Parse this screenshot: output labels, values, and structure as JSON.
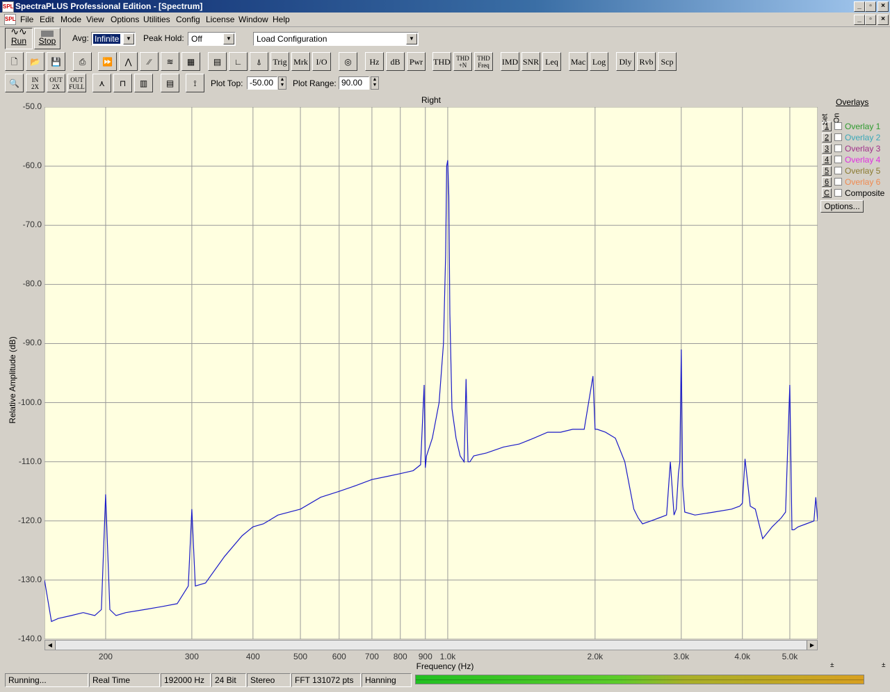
{
  "window": {
    "title": "SpectraPLUS Professional Edition - [Spectrum]",
    "icon_text": "SPL"
  },
  "menu": [
    "File",
    "Edit",
    "Mode",
    "View",
    "Options",
    "Utilities",
    "Config",
    "License",
    "Window",
    "Help"
  ],
  "toolbar": {
    "run_label": "Run",
    "stop_label": "Stop",
    "avg_label": "Avg:",
    "avg_value": "Infinite",
    "peak_hold_label": "Peak Hold:",
    "peak_hold_value": "Off",
    "load_config_value": "Load Configuration",
    "buttons": [
      "Trig",
      "Mrk",
      "I/O",
      "Hz",
      "dB",
      "Pwr",
      "THD",
      "THD +N",
      "THD Freq",
      "IMD",
      "SNR",
      "Leq",
      "Mac",
      "Log",
      "Dly",
      "Rvb",
      "Scp"
    ],
    "plot_top_label": "Plot Top:",
    "plot_top_value": "-50.00",
    "plot_range_label": "Plot Range:",
    "plot_range_value": "90.00"
  },
  "overlays": {
    "title": "Overlays",
    "col_set": "Set",
    "col_on": "On",
    "items": [
      {
        "set": "1",
        "label": "Overlay 1",
        "color": "#2e9a2e"
      },
      {
        "set": "2",
        "label": "Overlay 2",
        "color": "#3aa8b8"
      },
      {
        "set": "3",
        "label": "Overlay 3",
        "color": "#a0308a"
      },
      {
        "set": "4",
        "label": "Overlay 4",
        "color": "#e030e0"
      },
      {
        "set": "5",
        "label": "Overlay 5",
        "color": "#8a7a30"
      },
      {
        "set": "6",
        "label": "Overlay 6",
        "color": "#f08a50"
      },
      {
        "set": "C",
        "label": "Composite",
        "color": "#000000"
      }
    ],
    "options_label": "Options..."
  },
  "chart_data": {
    "type": "line",
    "title": "Right",
    "xlabel": "Frequency (Hz)",
    "ylabel": "Relative Amplitude (dB)",
    "xscale": "log",
    "xlim": [
      150,
      5700
    ],
    "ylim": [
      -140,
      -50
    ],
    "grid": true,
    "background": "#ffffe0",
    "line_color": "#1a1ac8",
    "yticks": [
      "-50.0",
      "-60.0",
      "-70.0",
      "-80.0",
      "-90.0",
      "-100.0",
      "-110.0",
      "-120.0",
      "-130.0",
      "-140.0"
    ],
    "xticks": [
      "200",
      "300",
      "400",
      "500",
      "600",
      "700",
      "800",
      "900",
      "1.0k",
      "2.0k",
      "3.0k",
      "4.0k",
      "5.0k"
    ],
    "series": [
      {
        "x": [
          150,
          155,
          160,
          170,
          180,
          190,
          196,
          200,
          204,
          210,
          220,
          240,
          260,
          280,
          295,
          300,
          305,
          320,
          350,
          380,
          400,
          420,
          450,
          500,
          550,
          600,
          650,
          700,
          750,
          800,
          850,
          880,
          895,
          900,
          905,
          930,
          960,
          980,
          990,
          995,
          1000,
          1005,
          1010,
          1020,
          1040,
          1060,
          1080,
          1090,
          1100,
          1110,
          1130,
          1200,
          1300,
          1400,
          1500,
          1600,
          1700,
          1800,
          1900,
          1980,
          2000,
          2020,
          2100,
          2200,
          2300,
          2400,
          2450,
          2500,
          2600,
          2700,
          2800,
          2850,
          2900,
          2930,
          2960,
          2980,
          3000,
          3020,
          3050,
          3200,
          3500,
          3800,
          3950,
          4000,
          4050,
          4150,
          4250,
          4400,
          4600,
          4800,
          4900,
          5000,
          5050,
          5100,
          5200,
          5400,
          5600,
          5650,
          5700
        ],
        "y": [
          -130,
          -137,
          -136.5,
          -136,
          -135.5,
          -136,
          -135,
          -115.5,
          -135,
          -136,
          -135.5,
          -135,
          -134.5,
          -134,
          -131,
          -118,
          -131,
          -130.5,
          -126,
          -122.5,
          -121,
          -120.5,
          -119,
          -118,
          -116,
          -115,
          -114,
          -113,
          -112.5,
          -112,
          -111.5,
          -110.5,
          -97,
          -111,
          -109,
          -106,
          -100,
          -90,
          -75,
          -60,
          -59,
          -65,
          -85,
          -101,
          -106,
          -109,
          -110,
          -96,
          -110,
          -110,
          -109,
          -108.5,
          -107.5,
          -107,
          -106,
          -105,
          -105,
          -104.5,
          -104.5,
          -95.5,
          -104.5,
          -104.5,
          -105,
          -106,
          -110,
          -118,
          -119.5,
          -120.5,
          -120,
          -119.5,
          -119,
          -110,
          -119,
          -118,
          -112,
          -110,
          -91,
          -114,
          -118.5,
          -119,
          -118.5,
          -118,
          -117.5,
          -117,
          -109.5,
          -117.5,
          -118,
          -123,
          -121,
          -119.5,
          -118.5,
          -97,
          -121.5,
          -121.5,
          -121,
          -120.5,
          -120,
          -116,
          -120
        ]
      }
    ]
  },
  "status": {
    "state": "Running...",
    "mode": "Real Time",
    "rate": "192000 Hz",
    "bits": "24 Bit",
    "channels": "Stereo",
    "fft": "FFT 131072 pts",
    "window": "Hanning"
  }
}
